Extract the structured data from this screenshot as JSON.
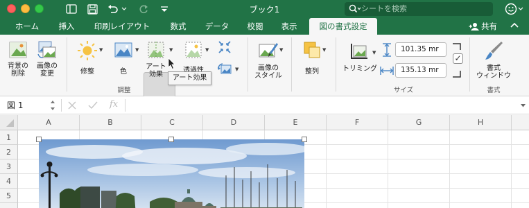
{
  "window": {
    "title": "ブック1"
  },
  "search": {
    "placeholder": "シートを検索"
  },
  "tabs": [
    {
      "label": "ホーム"
    },
    {
      "label": "挿入"
    },
    {
      "label": "印刷レイアウト"
    },
    {
      "label": "数式"
    },
    {
      "label": "データ"
    },
    {
      "label": "校閲"
    },
    {
      "label": "表示"
    },
    {
      "label": "図の書式設定",
      "active": true
    }
  ],
  "share_label": "共有",
  "ribbon": {
    "remove_bg": [
      "背景の",
      "削除"
    ],
    "change_pic": [
      "画像の",
      "変更"
    ],
    "corrections": "修整",
    "color": "色",
    "artistic_effects": [
      "アート",
      "効果"
    ],
    "transparency": "透過性",
    "adjust_group": "調整",
    "picture_styles": [
      "画像の",
      "スタイル"
    ],
    "arrange": "整列",
    "crop": "トリミング",
    "height_value": "101.35 mr",
    "width_value": "135.13 mr",
    "size_group": "サイズ",
    "format_pane": [
      "書式",
      "ウィンドウ"
    ],
    "format_group": "書式",
    "tooltip": "アート効果"
  },
  "formula_bar": {
    "name_box": "図 1",
    "fx": "fx",
    "formula": ""
  },
  "columns": [
    "A",
    "B",
    "C",
    "D",
    "E",
    "F",
    "G",
    "H"
  ],
  "rows": [
    "1",
    "2",
    "3",
    "4",
    "5"
  ],
  "colors": {
    "accent": "#217346",
    "ribbon_bg": "#f6f6f6"
  }
}
